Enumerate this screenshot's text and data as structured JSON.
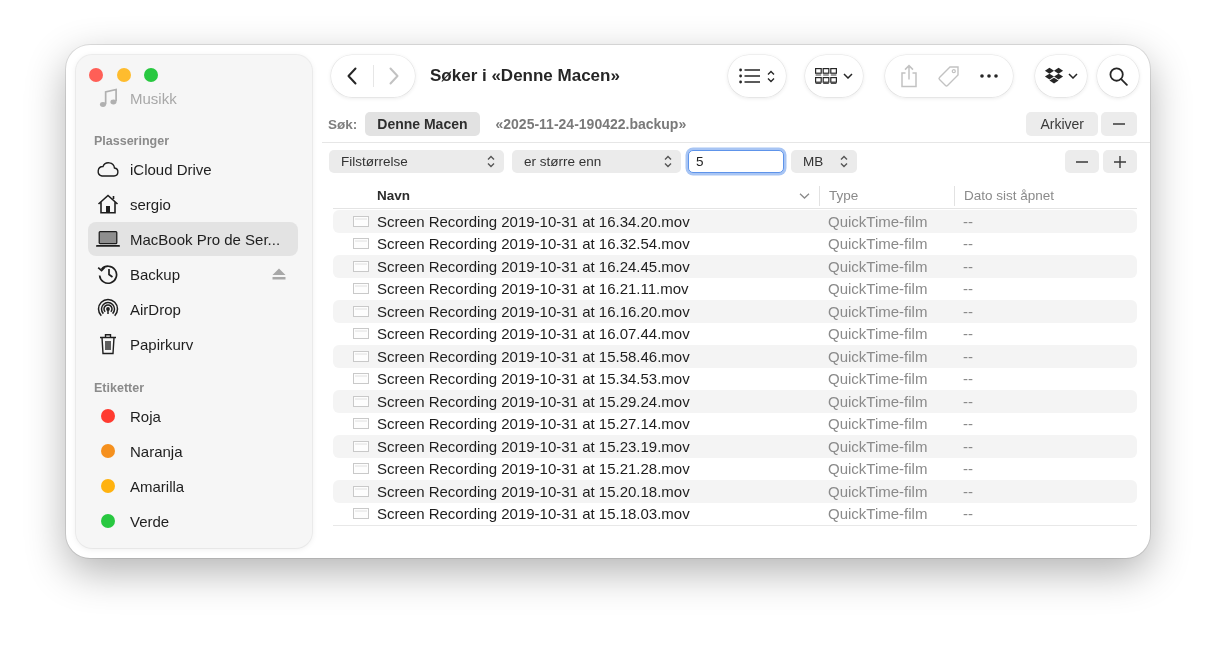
{
  "sidebar": {
    "scrolled_items": [
      {
        "label": "Musikk",
        "kind": "music"
      }
    ],
    "locations": {
      "title": "Plasseringer",
      "items": [
        {
          "label": "iCloud Drive",
          "kind": "cloud",
          "selected": false,
          "eject": false
        },
        {
          "label": "sergio",
          "kind": "home",
          "selected": false,
          "eject": false
        },
        {
          "label": "MacBook Pro de Ser...",
          "kind": "laptop",
          "selected": true,
          "eject": false
        },
        {
          "label": "Backup",
          "kind": "history",
          "selected": false,
          "eject": true
        },
        {
          "label": "AirDrop",
          "kind": "airdrop",
          "selected": false,
          "eject": false
        },
        {
          "label": "Papirkurv",
          "kind": "trash",
          "selected": false,
          "eject": false
        }
      ]
    },
    "tags": {
      "title": "Etiketter",
      "items": [
        {
          "label": "Roja",
          "color": "#ff3b30"
        },
        {
          "label": "Naranja",
          "color": "#f5901e"
        },
        {
          "label": "Amarilla",
          "color": "#ffb20f"
        },
        {
          "label": "Verde",
          "color": "#28c840"
        }
      ]
    }
  },
  "toolbar": {
    "nav": [
      {
        "kind": "back",
        "disabled": false
      },
      {
        "kind": "forward",
        "disabled": true
      }
    ],
    "title": "Søker i «Denne Macen»",
    "actions": [
      {
        "kind": "share",
        "disabled": true
      },
      {
        "kind": "tag",
        "disabled": true
      },
      {
        "kind": "more",
        "disabled": false
      }
    ]
  },
  "scope": {
    "label": "Søk:",
    "options": [
      {
        "label": "Denne Macen",
        "selected": true
      },
      {
        "label": "«2025-11-24-190422.backup»",
        "selected": false
      }
    ],
    "save_button": "Arkiver"
  },
  "criteria": {
    "attribute": "Filstørrelse",
    "operator": "er større enn",
    "value": "5",
    "unit": "MB",
    "focused": true
  },
  "table": {
    "columns": [
      {
        "label": "Navn",
        "sorted": true
      },
      {
        "label": "Type",
        "sorted": false
      },
      {
        "label": "Dato sist åpnet",
        "sorted": false
      }
    ],
    "rows": [
      {
        "name": "Screen Recording 2019-10-31 at 16.34.20.mov",
        "type": "QuickTime-film",
        "date_opened": "--"
      },
      {
        "name": "Screen Recording 2019-10-31 at 16.32.54.mov",
        "type": "QuickTime-film",
        "date_opened": "--"
      },
      {
        "name": "Screen Recording 2019-10-31 at 16.24.45.mov",
        "type": "QuickTime-film",
        "date_opened": "--"
      },
      {
        "name": "Screen Recording 2019-10-31 at 16.21.11.mov",
        "type": "QuickTime-film",
        "date_opened": "--"
      },
      {
        "name": "Screen Recording 2019-10-31 at 16.16.20.mov",
        "type": "QuickTime-film",
        "date_opened": "--"
      },
      {
        "name": "Screen Recording 2019-10-31 at 16.07.44.mov",
        "type": "QuickTime-film",
        "date_opened": "--"
      },
      {
        "name": "Screen Recording 2019-10-31 at 15.58.46.mov",
        "type": "QuickTime-film",
        "date_opened": "--"
      },
      {
        "name": "Screen Recording 2019-10-31 at 15.34.53.mov",
        "type": "QuickTime-film",
        "date_opened": "--"
      },
      {
        "name": "Screen Recording 2019-10-31 at 15.29.24.mov",
        "type": "QuickTime-film",
        "date_opened": "--"
      },
      {
        "name": "Screen Recording 2019-10-31 at 15.27.14.mov",
        "type": "QuickTime-film",
        "date_opened": "--"
      },
      {
        "name": "Screen Recording 2019-10-31 at 15.23.19.mov",
        "type": "QuickTime-film",
        "date_opened": "--"
      },
      {
        "name": "Screen Recording 2019-10-31 at 15.21.28.mov",
        "type": "QuickTime-film",
        "date_opened": "--"
      },
      {
        "name": "Screen Recording 2019-10-31 at 15.20.18.mov",
        "type": "QuickTime-film",
        "date_opened": "--"
      },
      {
        "name": "Screen Recording 2019-10-31 at 15.18.03.mov",
        "type": "QuickTime-film",
        "date_opened": "--"
      }
    ]
  }
}
